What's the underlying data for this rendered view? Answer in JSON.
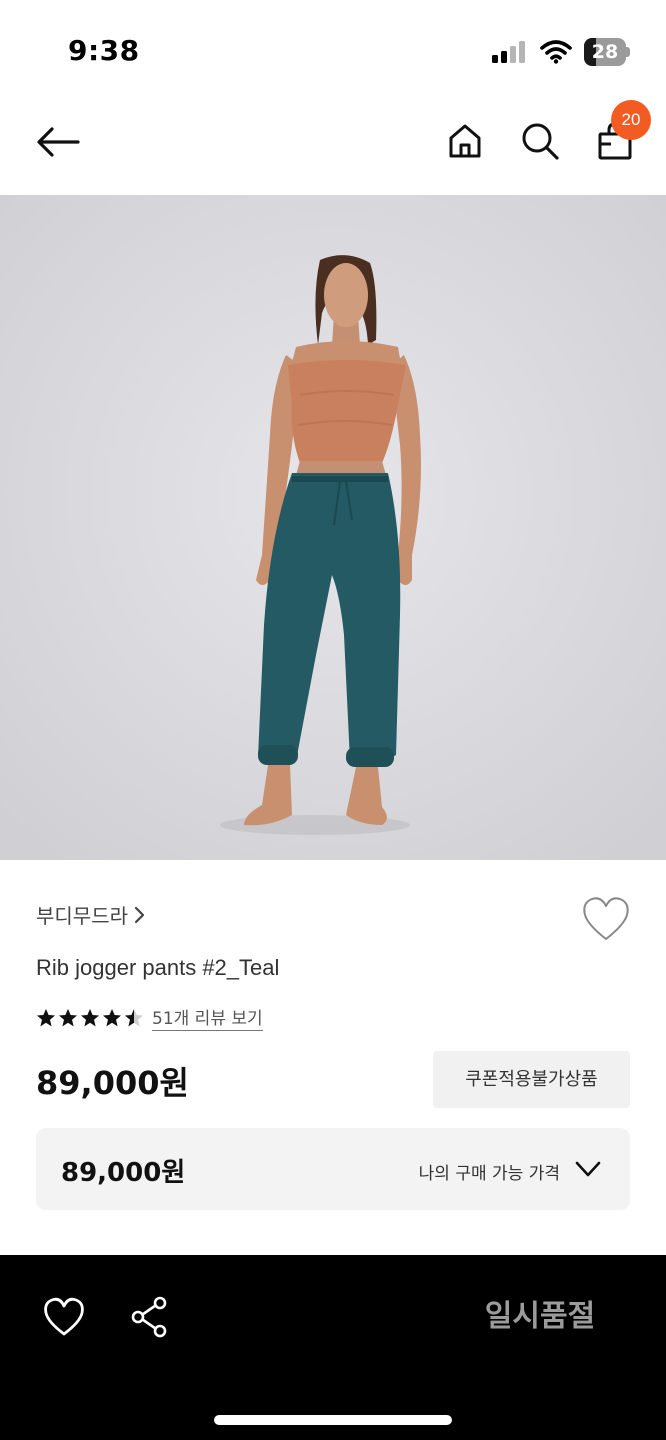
{
  "status_bar": {
    "time": "9:38",
    "battery": "28",
    "battery_level": 0.28,
    "icons": [
      "signal-icon",
      "wifi-icon",
      "battery-icon"
    ]
  },
  "nav": {
    "icons": [
      "back-arrow-icon",
      "home-icon",
      "search-icon",
      "shopping-bag-icon"
    ],
    "cart_count": "20"
  },
  "product": {
    "brand": "부디무드라",
    "title": "Rib jogger pants #2_Teal",
    "rating": 4.5,
    "review_link": "51개 리뷰 보기",
    "price": "89,000원",
    "coupon_label": "쿠폰적용불가상품",
    "my_price": "89,000원",
    "my_price_label": "나의 구매 가능 가격"
  },
  "bottom_bar": {
    "soldout_label": "일시품절",
    "icons": [
      "heart-icon",
      "share-icon"
    ]
  },
  "colors": {
    "accent": "#f25c22",
    "image_bg": "#d9d9dd",
    "top": "#c9805e",
    "pants": "#245a63"
  }
}
